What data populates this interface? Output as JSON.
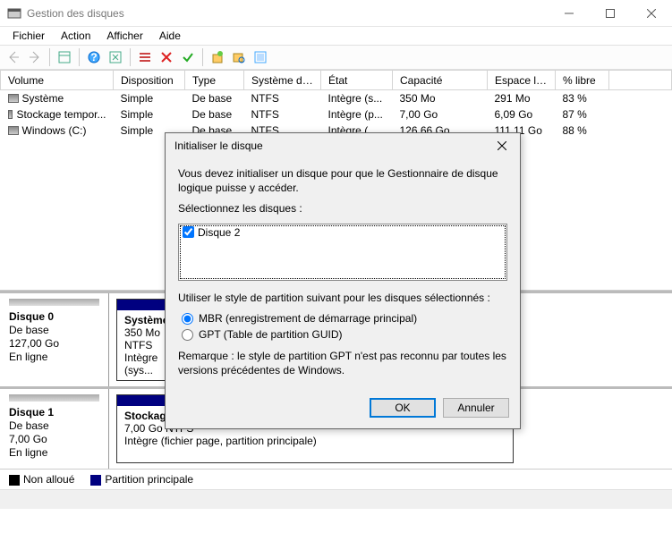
{
  "window": {
    "title": "Gestion des disques"
  },
  "menu": {
    "file": "Fichier",
    "action": "Action",
    "view": "Afficher",
    "help": "Aide"
  },
  "columns": {
    "volume": "Volume",
    "layout": "Disposition",
    "type": "Type",
    "fs": "Système de ...",
    "status": "État",
    "capacity": "Capacité",
    "free": "Espace libre",
    "pct": "% libre"
  },
  "rows": [
    {
      "name": "Système",
      "layout": "Simple",
      "type": "De base",
      "fs": "NTFS",
      "status": "Intègre (s...",
      "cap": "350 Mo",
      "free": "291 Mo",
      "pct": "83 %"
    },
    {
      "name": "Stockage tempor...",
      "layout": "Simple",
      "type": "De base",
      "fs": "NTFS",
      "status": "Intègre (p...",
      "cap": "7,00 Go",
      "free": "6,09 Go",
      "pct": "87 %"
    },
    {
      "name": "Windows (C:)",
      "layout": "Simple",
      "type": "De base",
      "fs": "NTFS",
      "status": "Intègre (...",
      "cap": "126,66 Go",
      "free": "111,11 Go",
      "pct": "88 %"
    }
  ],
  "disks": {
    "d0": {
      "name": "Disque 0",
      "type": "De base",
      "size": "127,00 Go",
      "state": "En ligne",
      "part1_name": "Système",
      "part1_size": "350 Mo NTFS",
      "part1_stat": "Intègre (sys..."
    },
    "d1": {
      "name": "Disque 1",
      "type": "De base",
      "size": "7,00 Go",
      "state": "En ligne",
      "part1_name": "Stockage temporaire  (D:)",
      "part1_size": "7,00 Go NTFS",
      "part1_stat": "Intègre (fichier page, partition principale)"
    }
  },
  "legend": {
    "unalloc": "Non alloué",
    "primary": "Partition principale"
  },
  "dialog": {
    "title": "Initialiser le disque",
    "msg": "Vous devez initialiser un disque pour que le Gestionnaire de disque logique puisse y accéder.",
    "select_label": "Sélectionnez les disques :",
    "disk_item": "Disque 2",
    "style_label": "Utiliser le style de partition suivant pour les disques sélectionnés :",
    "mbr": "MBR (enregistrement de démarrage principal)",
    "gpt": "GPT (Table de partition GUID)",
    "note": "Remarque : le style de partition GPT n'est pas reconnu par toutes les versions précédentes de Windows.",
    "ok": "OK",
    "cancel": "Annuler"
  }
}
